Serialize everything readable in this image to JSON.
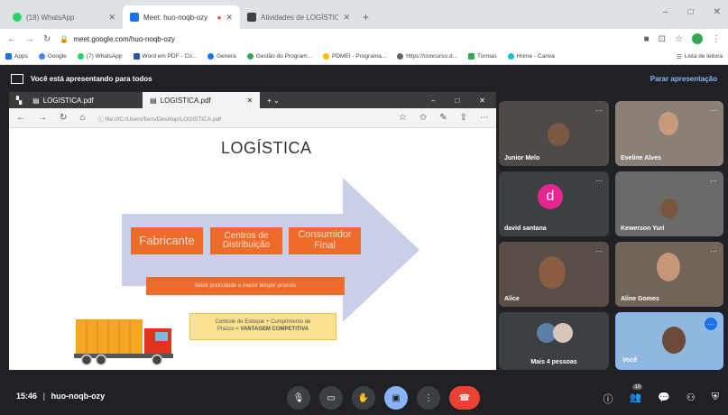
{
  "browser": {
    "tabs": [
      {
        "label": "(18) WhatsApp",
        "color": "#25d366"
      },
      {
        "label": "Meet: huo-noqb-ozy",
        "color": "#1a73e8"
      },
      {
        "label": "Atividades de LOGÍSTICA (N",
        "color": "#3c4043"
      }
    ],
    "url": "meet.google.com/huo-noqb-ozy",
    "bookmarks": [
      {
        "label": "Apps",
        "color": "#1a73e8"
      },
      {
        "label": "Google",
        "color": "#4285f4"
      },
      {
        "label": "(7) WhatsApp",
        "color": "#25d366"
      },
      {
        "label": "Word em PDF - Co...",
        "color": "#2b579a"
      },
      {
        "label": "Genera",
        "color": "#1a73e8"
      },
      {
        "label": "Gestão do Program...",
        "color": "#34a853"
      },
      {
        "label": "PDMEI - Programa...",
        "color": "#fbbc04"
      },
      {
        "label": "https://concurso.d...",
        "color": "#5f6368"
      },
      {
        "label": "Turmas",
        "color": "#34a853"
      },
      {
        "label": "Home - Canva",
        "color": "#00c4cc"
      }
    ],
    "reading_list": "Lista de leitura"
  },
  "meet": {
    "presenting_text": "Você está apresentando para todos",
    "stop_presenting": "Parar apresentação",
    "meeting_time": "15:46",
    "meeting_code": "huo-noqb-ozy",
    "participant_count": "10"
  },
  "shared_window": {
    "tabs": [
      "LOGISTICA.pdf",
      "LOGISTICA.pdf"
    ],
    "address": "file:///C:/Users/fiero/Desktop/LOGISTICA.pdf",
    "slide": {
      "title": "LOGÍSTICA",
      "boxes": [
        "Fabricante",
        "Centros de Distribuição",
        "Consumidor Final"
      ],
      "bar_text": "Maior praticidade e menor tempo/ produto",
      "note_line1": "Controle de Estoque + Cumprimento de",
      "note_line2": "Prazos = ",
      "note_bold": "VANTAGEM COMPETITIVA"
    }
  },
  "participants": [
    {
      "name": "Junior Melo"
    },
    {
      "name": "Eveline Alves"
    },
    {
      "name": "david santana",
      "initial": "d"
    },
    {
      "name": "Kewerson Yuri"
    },
    {
      "name": "Alice"
    },
    {
      "name": "Aline Gomes"
    },
    {
      "name": "Mais 4 pessoas"
    },
    {
      "name": "Você"
    }
  ]
}
